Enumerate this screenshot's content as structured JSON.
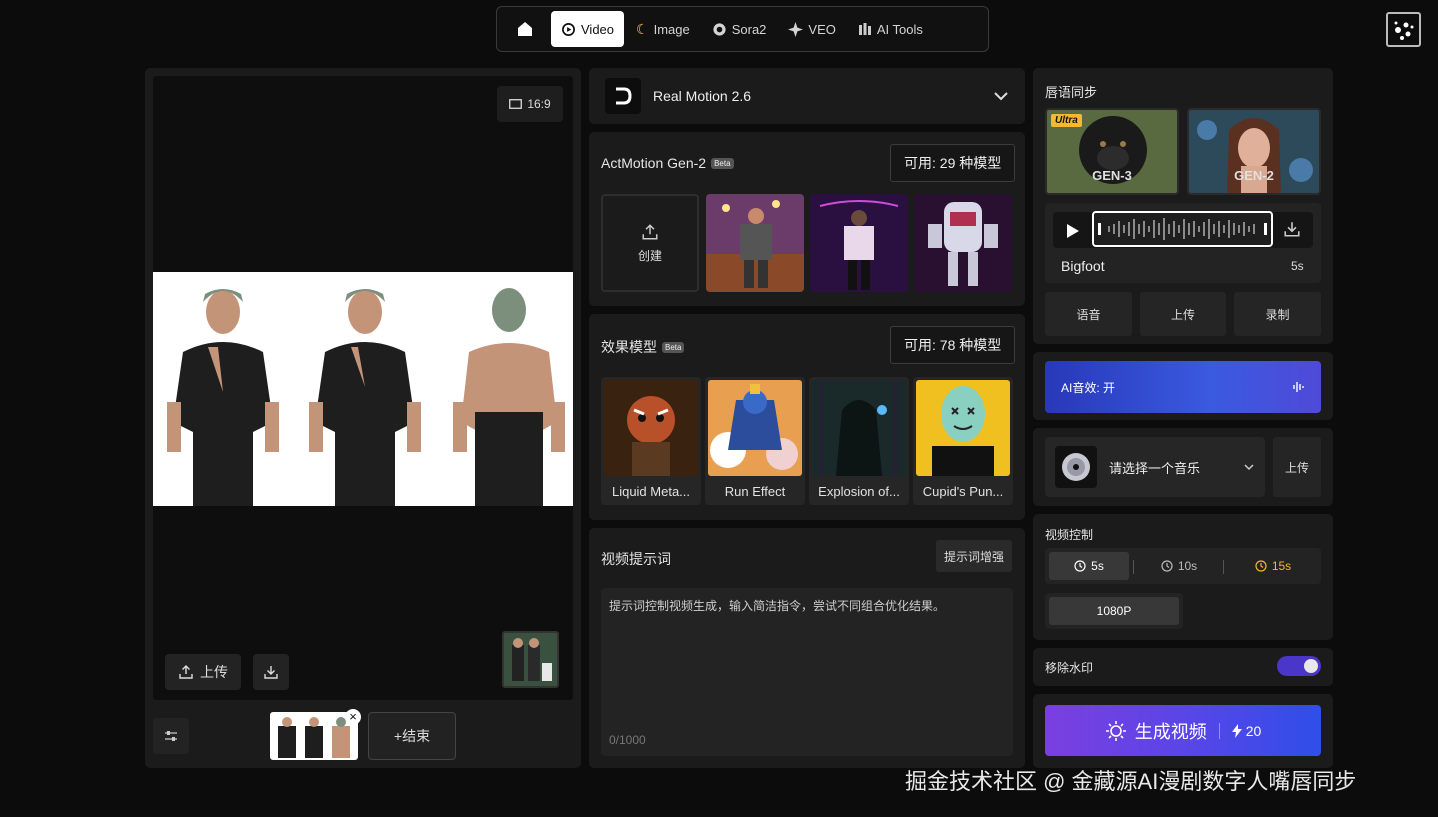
{
  "nav": {
    "tabs": [
      {
        "label": "Video",
        "icon": "video-icon"
      },
      {
        "label": "Image",
        "icon": "banana-icon"
      },
      {
        "label": "Sora2",
        "icon": "openai-icon"
      },
      {
        "label": "VEO",
        "icon": "sparkle-icon"
      },
      {
        "label": "AI Tools",
        "icon": "bars-icon"
      }
    ],
    "active": "Video"
  },
  "preview": {
    "ratio": "16:9",
    "upload_label": "上传",
    "end_label": "+结束"
  },
  "model": {
    "name": "Real Motion 2.6"
  },
  "actmotion": {
    "title": "ActMotion Gen-2",
    "beta": "Beta",
    "available": "可用: 29 种模型",
    "create_label": "创建"
  },
  "effects": {
    "title": "效果模型",
    "beta": "Beta",
    "available": "可用: 78 种模型",
    "cards": [
      {
        "label": "Liquid Meta..."
      },
      {
        "label": "Run Effect"
      },
      {
        "label": "Explosion of..."
      },
      {
        "label": "Cupid's Pun..."
      }
    ]
  },
  "prompt": {
    "title": "视频提示词",
    "enhance_label": "提示词增强",
    "placeholder": "提示词控制视频生成，输入简洁指令，尝试不同组合优化结果。",
    "counter": "0/1000"
  },
  "lipsync": {
    "title": "唇语同步",
    "gens": [
      {
        "label": "GEN-3",
        "badge": "Ultra"
      },
      {
        "label": "GEN-2"
      }
    ],
    "audio_name": "Bigfoot",
    "audio_duration": "5s",
    "buttons": [
      "语音",
      "上传",
      "录制"
    ]
  },
  "ai_sound": {
    "label": "AI音效: 开"
  },
  "music": {
    "placeholder": "请选择一个音乐",
    "upload_label": "上传"
  },
  "video_control": {
    "title": "视频控制",
    "durations": [
      "5s",
      "10s",
      "15s"
    ],
    "selected_duration": "5s",
    "resolution": "1080P"
  },
  "watermark": {
    "label": "移除水印",
    "enabled": true
  },
  "generate": {
    "label": "生成视频",
    "cost": "20"
  },
  "watermark_text": "掘金技术社区 @ 金藏源AI漫剧数字人嘴唇同步",
  "colors": {
    "accent": "#5b3de0",
    "gold": "#f5b82e",
    "gen_gradient_start": "#7b3fe0",
    "gen_gradient_end": "#2f4ee8"
  }
}
